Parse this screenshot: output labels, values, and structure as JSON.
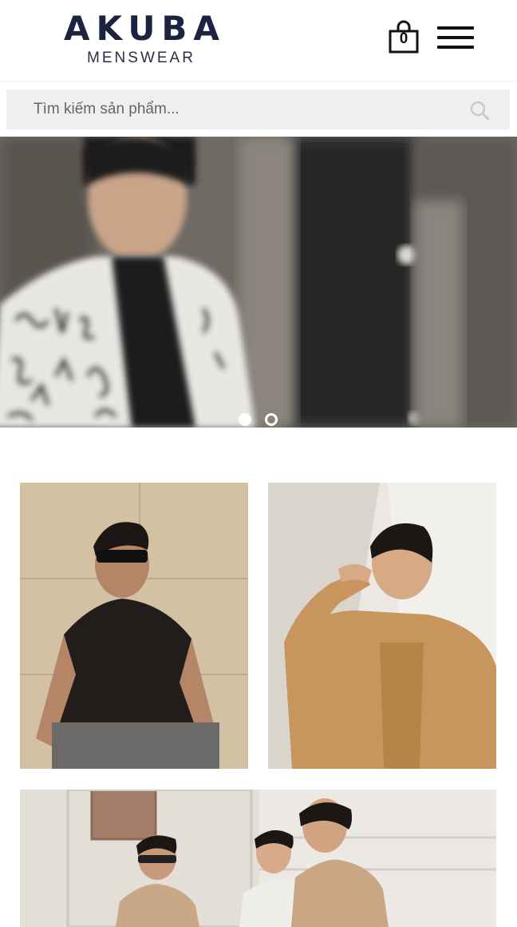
{
  "header": {
    "logo": {
      "main": "AKUBA",
      "sub": "MENSWEAR"
    },
    "cart": {
      "count": "0",
      "icon": "shopping-bag-icon"
    },
    "menu_icon": "hamburger-menu-icon"
  },
  "search": {
    "placeholder": "Tìm kiếm sản phẩm...",
    "value": "",
    "icon": "search-icon"
  },
  "banner": {
    "slides": 2,
    "active_slide": 1,
    "image": "model-in-printed-white-jacket-photo"
  },
  "collection": {
    "tiles": [
      {
        "image": "man-with-sunglasses-black-polo-photo"
      },
      {
        "image": "man-in-tan-overshirt-photo"
      },
      {
        "image": "three-men-in-blazers-photo"
      }
    ]
  },
  "colors": {
    "brand": "#1c2340",
    "search_bg": "#efefef",
    "icon": "#111111"
  }
}
